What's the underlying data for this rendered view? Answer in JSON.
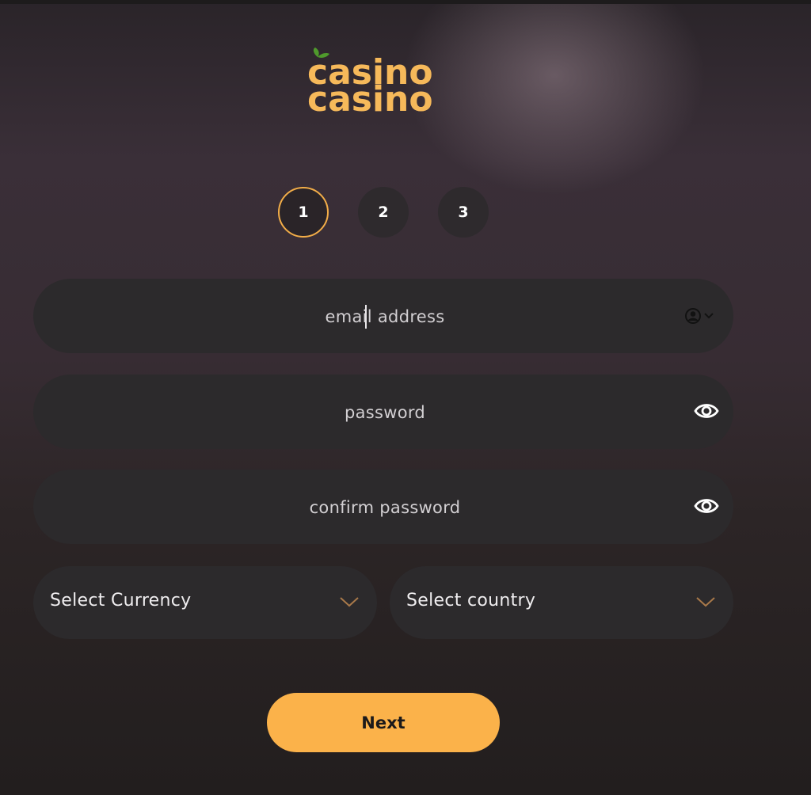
{
  "logo": {
    "line1": "casino",
    "line2": "casino"
  },
  "steps": [
    "1",
    "2",
    "3"
  ],
  "active_step": 1,
  "form": {
    "email": {
      "placeholder": "email address"
    },
    "password": {
      "placeholder": "password"
    },
    "confirm_password": {
      "placeholder": "confirm password"
    },
    "currency": {
      "label": "Select Currency"
    },
    "country": {
      "label": "Select country"
    },
    "next_label": "Next"
  },
  "colors": {
    "accent": "#fbb24a",
    "logo": "#f6b95a",
    "field_bg": "#2c2a2c",
    "leaf": "#4f9a2c"
  },
  "icons": {
    "email_field": "contact-dropdown-icon",
    "password_field": "eye-icon",
    "confirm_field": "eye-icon",
    "selects": "chevron-down-icon"
  }
}
